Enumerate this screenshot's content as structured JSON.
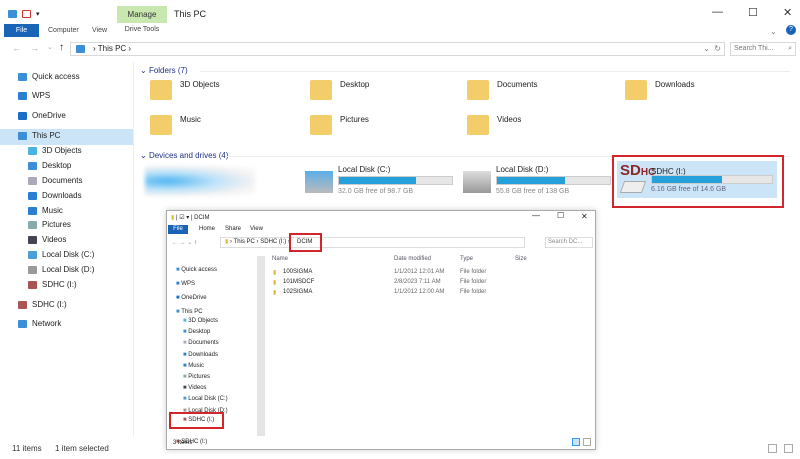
{
  "window": {
    "title": "This PC",
    "manage_tab": "Manage",
    "drive_tools": "Drive Tools",
    "tabs": [
      "File",
      "Computer",
      "View"
    ]
  },
  "address": {
    "path": [
      "This PC"
    ],
    "search_placeholder": "Search Thi..."
  },
  "sidebar": {
    "items": [
      "Quick access",
      "WPS",
      "OneDrive",
      "This PC",
      "3D Objects",
      "Desktop",
      "Documents",
      "Downloads",
      "Music",
      "Pictures",
      "Videos",
      "Local Disk (C:)",
      "Local Disk (D:)",
      "SDHC (I:)",
      "SDHC (I:)",
      "Network"
    ]
  },
  "folders": {
    "header": "Folders (7)",
    "items": [
      "3D Objects",
      "Desktop",
      "Documents",
      "Downloads",
      "Music",
      "Pictures",
      "Videos"
    ]
  },
  "devices": {
    "header": "Devices and drives (4)",
    "drives": [
      {
        "name": "Local Disk (C:)",
        "free": "32.0 GB free of 98.7 GB",
        "used_pct": 68
      },
      {
        "name": "Local Disk (D:)",
        "free": "55.8 GB free of 138 GB",
        "used_pct": 60
      },
      {
        "name": "SDHC (I:)",
        "free": "6.16 GB free of 14.6 GB",
        "used_pct": 58,
        "logo": "SDHC"
      }
    ]
  },
  "status": {
    "count": "11 items",
    "selected": "1 item selected"
  },
  "inner": {
    "title": "DCIM",
    "tabs": [
      "File",
      "Home",
      "Share",
      "View"
    ],
    "path": [
      "This PC",
      "SDHC (I:)",
      "DCIM"
    ],
    "search_placeholder": "Search DC...",
    "columns": [
      "Name",
      "Date modified",
      "Type",
      "Size"
    ],
    "rows": [
      {
        "name": "100SIGMA",
        "date": "1/1/2012 12:01 AM",
        "type": "File folder"
      },
      {
        "name": "101MSDCF",
        "date": "2/8/2023 7:11 AM",
        "type": "File folder"
      },
      {
        "name": "102SIGMA",
        "date": "1/1/2012 12:00 AM",
        "type": "File folder"
      }
    ],
    "sidebar": [
      "Quick access",
      "WPS",
      "OneDrive",
      "This PC",
      "3D Objects",
      "Desktop",
      "Documents",
      "Downloads",
      "Music",
      "Pictures",
      "Videos",
      "Local Disk (C:)",
      "Local Disk (D:)",
      "SDHC (I:)",
      "SDHC (I:)"
    ],
    "status": "3 items"
  }
}
